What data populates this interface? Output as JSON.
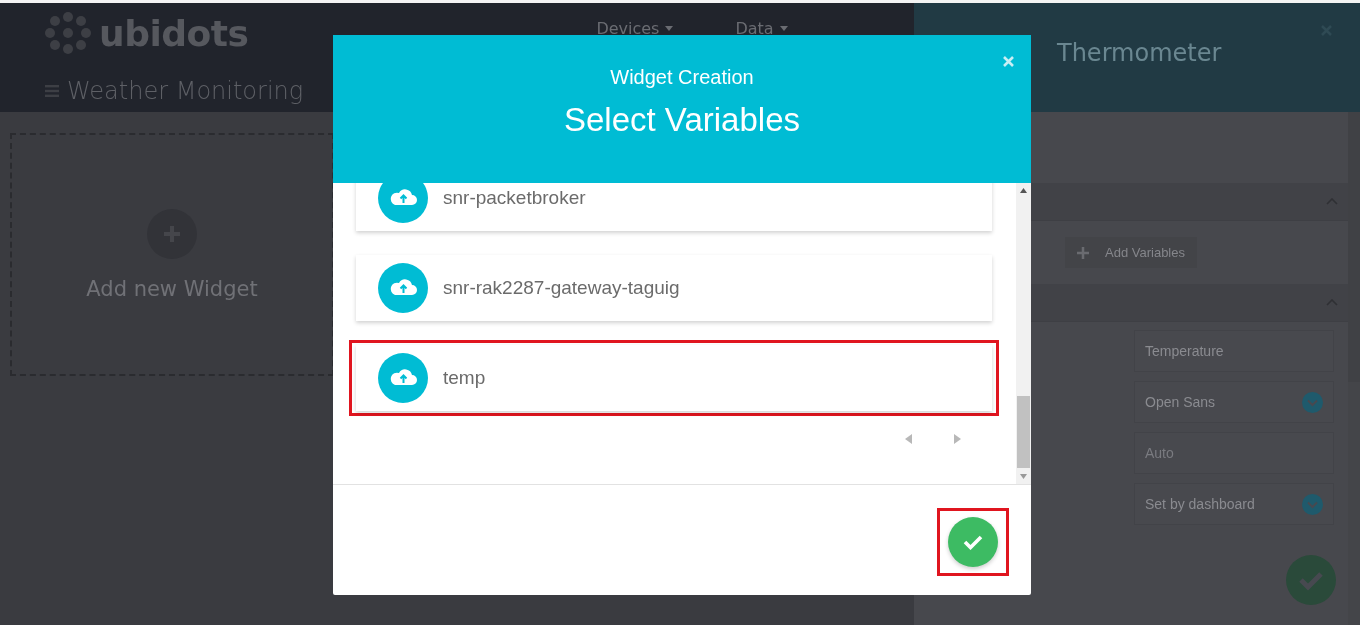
{
  "app_header": {
    "logo": "ubidots",
    "nav": [
      {
        "label": "Devices"
      },
      {
        "label": "Data"
      }
    ],
    "dashboard_title": "Weather Monitoring"
  },
  "canvas": {
    "add_widget_label": "Add new Widget"
  },
  "settings_panel": {
    "title": "Thermometer",
    "add_variables": "Add Variables",
    "fields": [
      {
        "kind": "input",
        "value": "Temperature"
      },
      {
        "kind": "select",
        "value": "Open Sans"
      },
      {
        "kind": "input",
        "placeholder": "Auto"
      },
      {
        "kind": "select",
        "value": "Set by dashboard"
      }
    ]
  },
  "modal": {
    "subtitle": "Widget Creation",
    "title": "Select Variables",
    "variables": [
      {
        "name": "snr-packetbroker",
        "highlighted": false
      },
      {
        "name": "snr-rak2287-gateway-taguig",
        "highlighted": false
      },
      {
        "name": "temp",
        "highlighted": true
      }
    ],
    "confirm_highlighted": true
  }
}
